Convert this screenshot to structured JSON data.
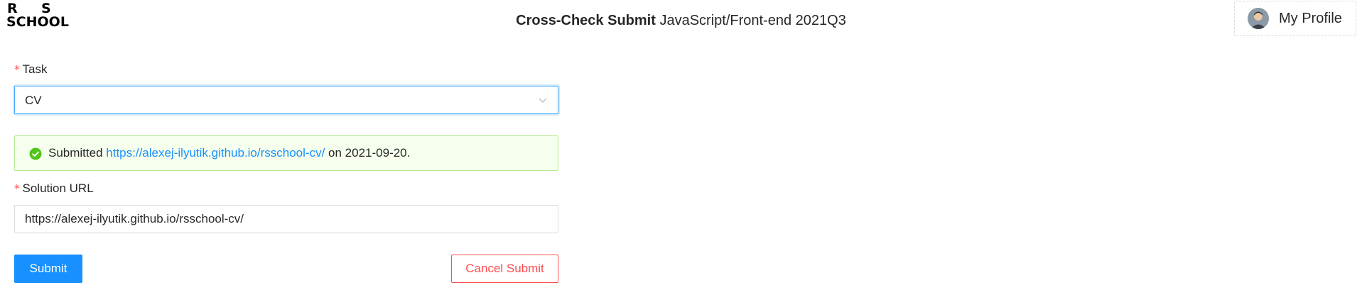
{
  "header": {
    "logo_line1_left": "R",
    "logo_line1_right": "S",
    "logo_line2": "SCHOOL",
    "title_strong": "Cross-Check Submit",
    "title_light": "JavaScript/Front-end 2021Q3",
    "profile_label": "My Profile"
  },
  "form": {
    "task_label": "Task",
    "task_value": "CV",
    "alert": {
      "prefix": "Submitted",
      "link": "https://alexej-ilyutik.github.io/rsschool-cv/",
      "suffix": "on 2021-09-20."
    },
    "solution_label": "Solution URL",
    "solution_value": "https://alexej-ilyutik.github.io/rsschool-cv/",
    "submit_label": "Submit",
    "cancel_label": "Cancel Submit"
  },
  "colors": {
    "primary": "#1890ff",
    "danger": "#ff4d4f",
    "success": "#52c41a",
    "success_bg": "#f6ffed",
    "success_border": "#b7eb8f"
  },
  "icons": {
    "select_arrow": "chevron-down-icon",
    "alert_icon": "check-circle-icon",
    "required": "asterisk"
  }
}
